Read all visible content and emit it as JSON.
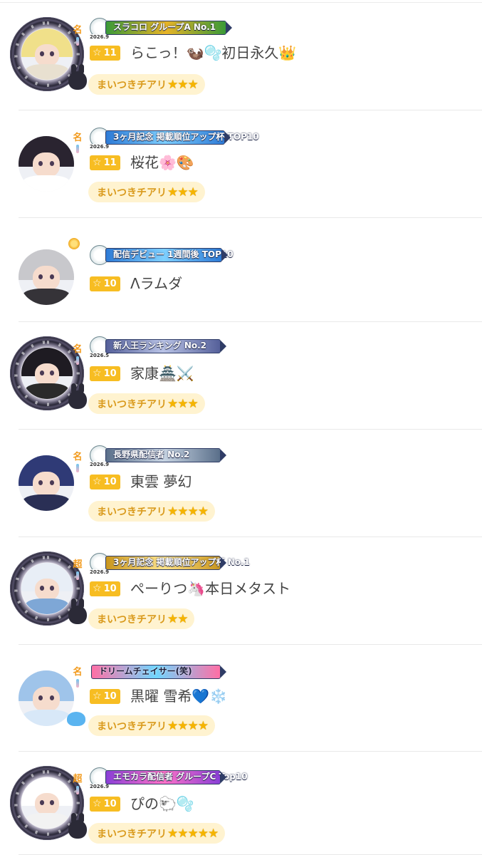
{
  "level_icon": "star-outline-icon",
  "cheer_star_icon": "star-filled-icon",
  "colors": {
    "level_chip": "#f7bd22",
    "cheer_pill_bg": "#fff3d0",
    "cheer_text": "#d99a1c",
    "star": "#f5b400"
  },
  "rows": [
    {
      "frame": "dark-ornate",
      "rank_mark": "名",
      "badge": {
        "year": "2026.9",
        "text": "スラコロ グループA No.1",
        "colors": [
          "#3a9a38",
          "#e8b427"
        ]
      },
      "level": "11",
      "name": "らこっ！🦦🫧初日永久👑",
      "cheer": {
        "label": "まいつきチアリ",
        "stars": "★★★"
      },
      "palette": {
        "hair": "#f0e08a",
        "body": "#e8e0d0"
      }
    },
    {
      "frame": "none",
      "rank_mark": "名",
      "badge": {
        "year": "2026.9",
        "text": "3ヶ月記念 掲載順位アップ杯 TOP10",
        "colors": [
          "#2e7bd6",
          "#7ed0ff"
        ]
      },
      "level": "11",
      "name": "桜花🌸🎨",
      "cheer": {
        "label": "まいつきチアリ",
        "stars": "★★★"
      },
      "palette": {
        "hair": "#2a2430",
        "body": "#ffffff"
      }
    },
    {
      "frame": "none",
      "rank_mark": "",
      "badge": {
        "year": "",
        "text": "配信デビュー 1週間後 TOP10",
        "colors": [
          "#2e7bd6",
          "#7ed0ff"
        ]
      },
      "level": "10",
      "name": "Λラムダ",
      "cheer": null,
      "palette": {
        "hair": "#c8c8cc",
        "body": "#353338"
      }
    },
    {
      "frame": "dark-ornate",
      "rank_mark": "名",
      "badge": {
        "year": "2026.5",
        "text": "新人王ランキング No.2",
        "colors": [
          "#55609a",
          "#b9c3e6"
        ]
      },
      "level": "10",
      "name": "家康🏯⚔️",
      "cheer": {
        "label": "まいつきチアリ",
        "stars": "★★★"
      },
      "palette": {
        "hair": "#1e1b22",
        "body": "#2a2a2a"
      }
    },
    {
      "frame": "none",
      "rank_mark": "名",
      "badge": {
        "year": "2026.9",
        "text": "長野県配信者 No.2",
        "colors": [
          "#5a6f8a",
          "#c9d6e4"
        ]
      },
      "level": "10",
      "name": "東雲 夢幻",
      "cheer": {
        "label": "まいつきチアリ",
        "stars": "★★★★"
      },
      "palette": {
        "hair": "#2f3a76",
        "body": "#2a2f55"
      }
    },
    {
      "frame": "dark-ornate",
      "rank_mark": "超",
      "badge": {
        "year": "2026.9",
        "text": "3ヶ月記念 掲載順位アップ杯 No.1",
        "colors": [
          "#c9961e",
          "#ffe48a"
        ]
      },
      "level": "10",
      "name": "ぺーりつ🦄本日メタスト",
      "cheer": {
        "label": "まいつきチアリ",
        "stars": "★★"
      },
      "palette": {
        "hair": "#e8eef6",
        "body": "#7ea7d6"
      }
    },
    {
      "frame": "none",
      "rank_mark": "名",
      "badge": {
        "year": "",
        "text": "ドリームチェイサー(笑)",
        "colors": [
          "#ff6fa5",
          "#6fd6ff"
        ]
      },
      "level": "10",
      "name": "黒曜 雪希💙❄️",
      "cheer": {
        "label": "まいつきチアリ",
        "stars": "★★★★"
      },
      "palette": {
        "hair": "#9fc4ea",
        "body": "#d8e8f8"
      }
    },
    {
      "frame": "dark-ornate",
      "rank_mark": "超",
      "badge": {
        "year": "2026.9",
        "text": "エモカラ配信者 グループC Top10",
        "colors": [
          "#8a3fd6",
          "#ff72c8"
        ]
      },
      "level": "10",
      "name": "ぴの🐑🫧",
      "cheer": {
        "label": "まいつきチアリ",
        "stars": "★★★★★"
      },
      "palette": {
        "hair": "#ffffff",
        "body": "#f2f2f2"
      }
    }
  ]
}
